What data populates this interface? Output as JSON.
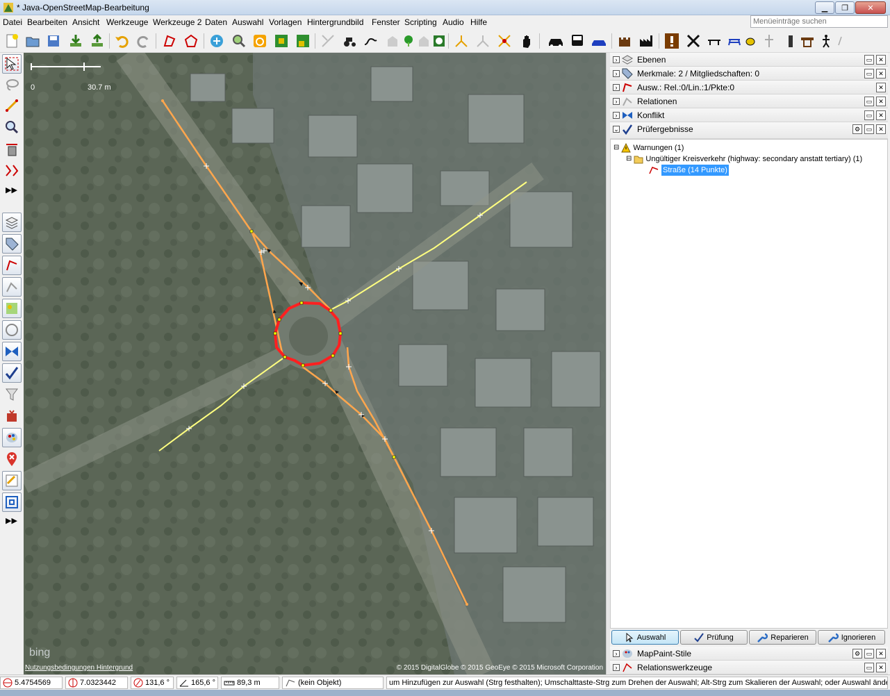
{
  "window": {
    "title": "* Java-OpenStreetMap-Bearbeitung",
    "minimize": "▁",
    "restore": "❐",
    "close": "✕"
  },
  "menu": {
    "items": [
      "Datei",
      "Bearbeiten",
      "Ansicht",
      "Werkzeuge",
      "Werkzeuge 2",
      "Daten",
      "Auswahl",
      "Vorlagen",
      "Hintergrundbild",
      "Fenster",
      "Scripting",
      "Audio",
      "Hilfe"
    ],
    "search_placeholder": "Menüeinträge suchen"
  },
  "map": {
    "scale_left": "0",
    "scale_right": "30.7 m",
    "credit": "© 2015 DigitalGlobe © 2015 GeoEye © 2015 Microsoft Corporation",
    "terms": "Nutzungsbedingungen Hintergrund",
    "bing": "bing"
  },
  "panels": {
    "ebenen": "Ebenen",
    "merkmale": "Merkmale: 2 / Mitgliedschaften: 0",
    "auswahl": "Ausw.: Rel.:0/Lin.:1/Pkte:0",
    "relationen": "Relationen",
    "konflikt": "Konflikt",
    "pruef": "Prüfergebnisse",
    "mappaint": "MapPaint-Stile",
    "relwerk": "Relationswerkzeuge"
  },
  "tree": {
    "warnungen": "Warnungen (1)",
    "issue": "Ungültiger Kreisverkehr (highway: secondary anstatt tertiary) (1)",
    "way": "Straße (14 Punkte)"
  },
  "buttons": {
    "auswahl": "Auswahl",
    "pruefung": "Prüfung",
    "reparieren": "Reparieren",
    "ignorieren": "Ignorieren"
  },
  "status": {
    "lat": "5.4754569",
    "lon": "7.0323442",
    "heading": "131,6 °",
    "angle": "165,6 °",
    "length": "89,3 m",
    "object": "(kein Objekt)",
    "help": "um Hinzufügen zur Auswahl (Strg festhalten); Umschalttaste-Strg zum Drehen der Auswahl; Alt-Strg zum Skalieren der Auswahl; oder Auswahl ändern"
  },
  "colors": {
    "selected_way": "#ffa64d",
    "secondary_way": "#ffff80",
    "roundabout_error": "#ff0000",
    "selection_blue": "#3399ff"
  }
}
